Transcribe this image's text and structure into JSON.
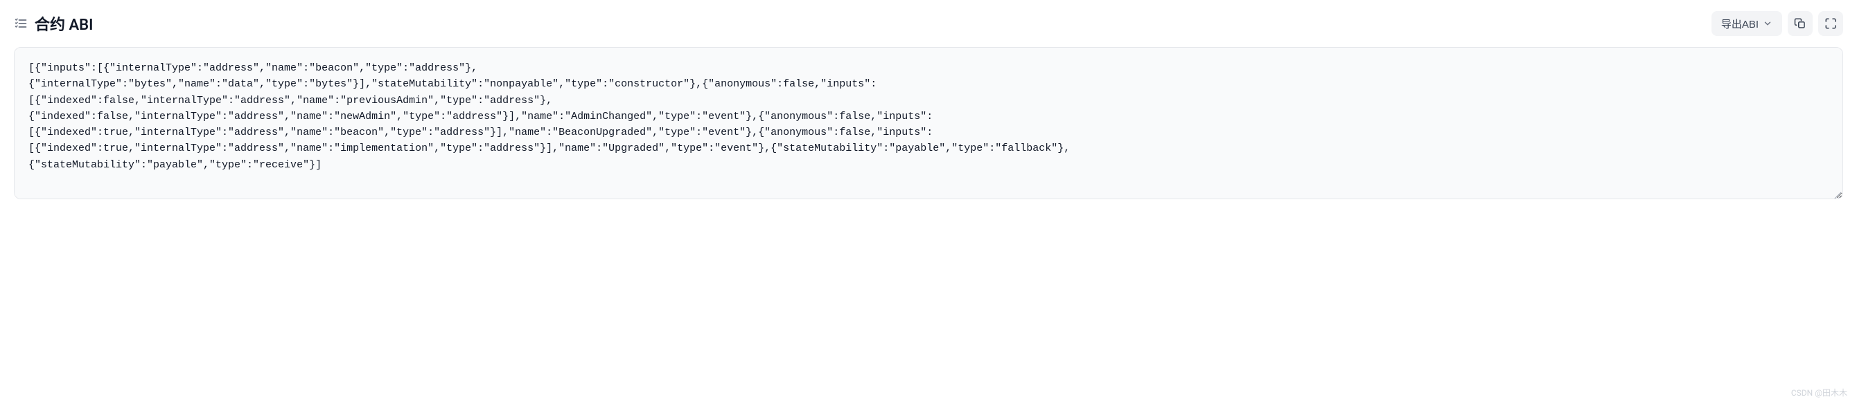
{
  "header": {
    "title": "合约 ABI",
    "export_label": "导出ABI"
  },
  "code": {
    "content": "[{\"inputs\":[{\"internalType\":\"address\",\"name\":\"beacon\",\"type\":\"address\"},\n{\"internalType\":\"bytes\",\"name\":\"data\",\"type\":\"bytes\"}],\"stateMutability\":\"nonpayable\",\"type\":\"constructor\"},{\"anonymous\":false,\"inputs\":\n[{\"indexed\":false,\"internalType\":\"address\",\"name\":\"previousAdmin\",\"type\":\"address\"},\n{\"indexed\":false,\"internalType\":\"address\",\"name\":\"newAdmin\",\"type\":\"address\"}],\"name\":\"AdminChanged\",\"type\":\"event\"},{\"anonymous\":false,\"inputs\":\n[{\"indexed\":true,\"internalType\":\"address\",\"name\":\"beacon\",\"type\":\"address\"}],\"name\":\"BeaconUpgraded\",\"type\":\"event\"},{\"anonymous\":false,\"inputs\":\n[{\"indexed\":true,\"internalType\":\"address\",\"name\":\"implementation\",\"type\":\"address\"}],\"name\":\"Upgraded\",\"type\":\"event\"},{\"stateMutability\":\"payable\",\"type\":\"fallback\"},\n{\"stateMutability\":\"payable\",\"type\":\"receive\"}]"
  },
  "watermark": "CSDN @田木木"
}
